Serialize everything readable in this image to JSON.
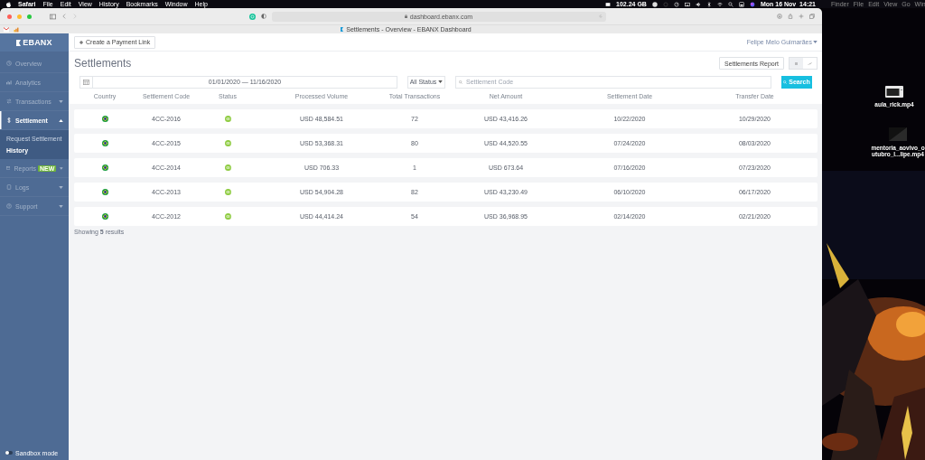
{
  "menubar": {
    "menus": [
      "Safari",
      "File",
      "Edit",
      "View",
      "History",
      "Bookmarks",
      "Window",
      "Help"
    ],
    "storage": "102.24 GB",
    "clock": "Mon 16 Nov  14:21",
    "second_display_menus": [
      "Finder",
      "File",
      "Edit",
      "View",
      "Go",
      "Win"
    ]
  },
  "browser": {
    "url": "dashboard.ebanx.com",
    "tab_title": "Settlements - Overview - EBANX Dashboard"
  },
  "sidebar": {
    "logo": "EBANX",
    "items": [
      {
        "label": "Overview",
        "selected": false
      },
      {
        "label": "Analytics",
        "selected": false
      },
      {
        "label": "Transactions",
        "selected": false,
        "expanded": false
      },
      {
        "label": "Settlement",
        "selected": true,
        "expanded": true,
        "children": [
          {
            "label": "Request Settlement",
            "selected": false
          },
          {
            "label": "History",
            "selected": true
          }
        ]
      },
      {
        "label": "Reports",
        "badge": "NEW",
        "selected": false,
        "expanded": false
      },
      {
        "label": "Logs",
        "selected": false,
        "expanded": false
      },
      {
        "label": "Support",
        "selected": false,
        "expanded": false
      }
    ],
    "sandbox": {
      "label": "Sandbox mode",
      "on": false
    }
  },
  "header": {
    "create_button": "Create a Payment Link",
    "user": "Felipe Melo Guimarães"
  },
  "page": {
    "title": "Settlements",
    "report_button": "Settlements Report",
    "view_toggle": [
      {
        "kind": "list",
        "selected": true
      },
      {
        "kind": "chart",
        "selected": false
      }
    ]
  },
  "filters": {
    "date_range": "01/01/2020 — 11/16/2020",
    "status": "All Status",
    "search": {
      "placeholder": "Settlement Code"
    },
    "search_button": "Search"
  },
  "table": {
    "columns": [
      "Country",
      "Settlement Code",
      "Status",
      "Processed Volume",
      "Total Transactions",
      "Net Amount",
      "Settlement Date",
      "Transfer Date"
    ],
    "rows": [
      {
        "code": "4CC-2016",
        "processed_volume": "USD 48,584.51",
        "total_transactions": "72",
        "net_amount": "USD 43,416.26",
        "settlement_date": "10/22/2020",
        "transfer_date": "10/29/2020"
      },
      {
        "code": "4CC-2015",
        "processed_volume": "USD 53,368.31",
        "total_transactions": "80",
        "net_amount": "USD 44,520.55",
        "settlement_date": "07/24/2020",
        "transfer_date": "08/03/2020"
      },
      {
        "code": "4CC-2014",
        "processed_volume": "USD 706.33",
        "total_transactions": "1",
        "net_amount": "USD 673.64",
        "settlement_date": "07/16/2020",
        "transfer_date": "07/23/2020"
      },
      {
        "code": "4CC-2013",
        "processed_volume": "USD 54,904.28",
        "total_transactions": "82",
        "net_amount": "USD 43,230.49",
        "settlement_date": "06/10/2020",
        "transfer_date": "06/17/2020"
      },
      {
        "code": "4CC-2012",
        "processed_volume": "USD 44,414.24",
        "total_transactions": "54",
        "net_amount": "USD 36,968.95",
        "settlement_date": "02/14/2020",
        "transfer_date": "02/21/2020"
      }
    ]
  },
  "results": "Showing **5** results",
  "desktop": {
    "files": [
      {
        "name": "aula_rick.mp4",
        "kind": "window"
      },
      {
        "name": "mentoria_aovivo_outubro_l...lipe.mp4",
        "kind": "dark"
      }
    ]
  }
}
